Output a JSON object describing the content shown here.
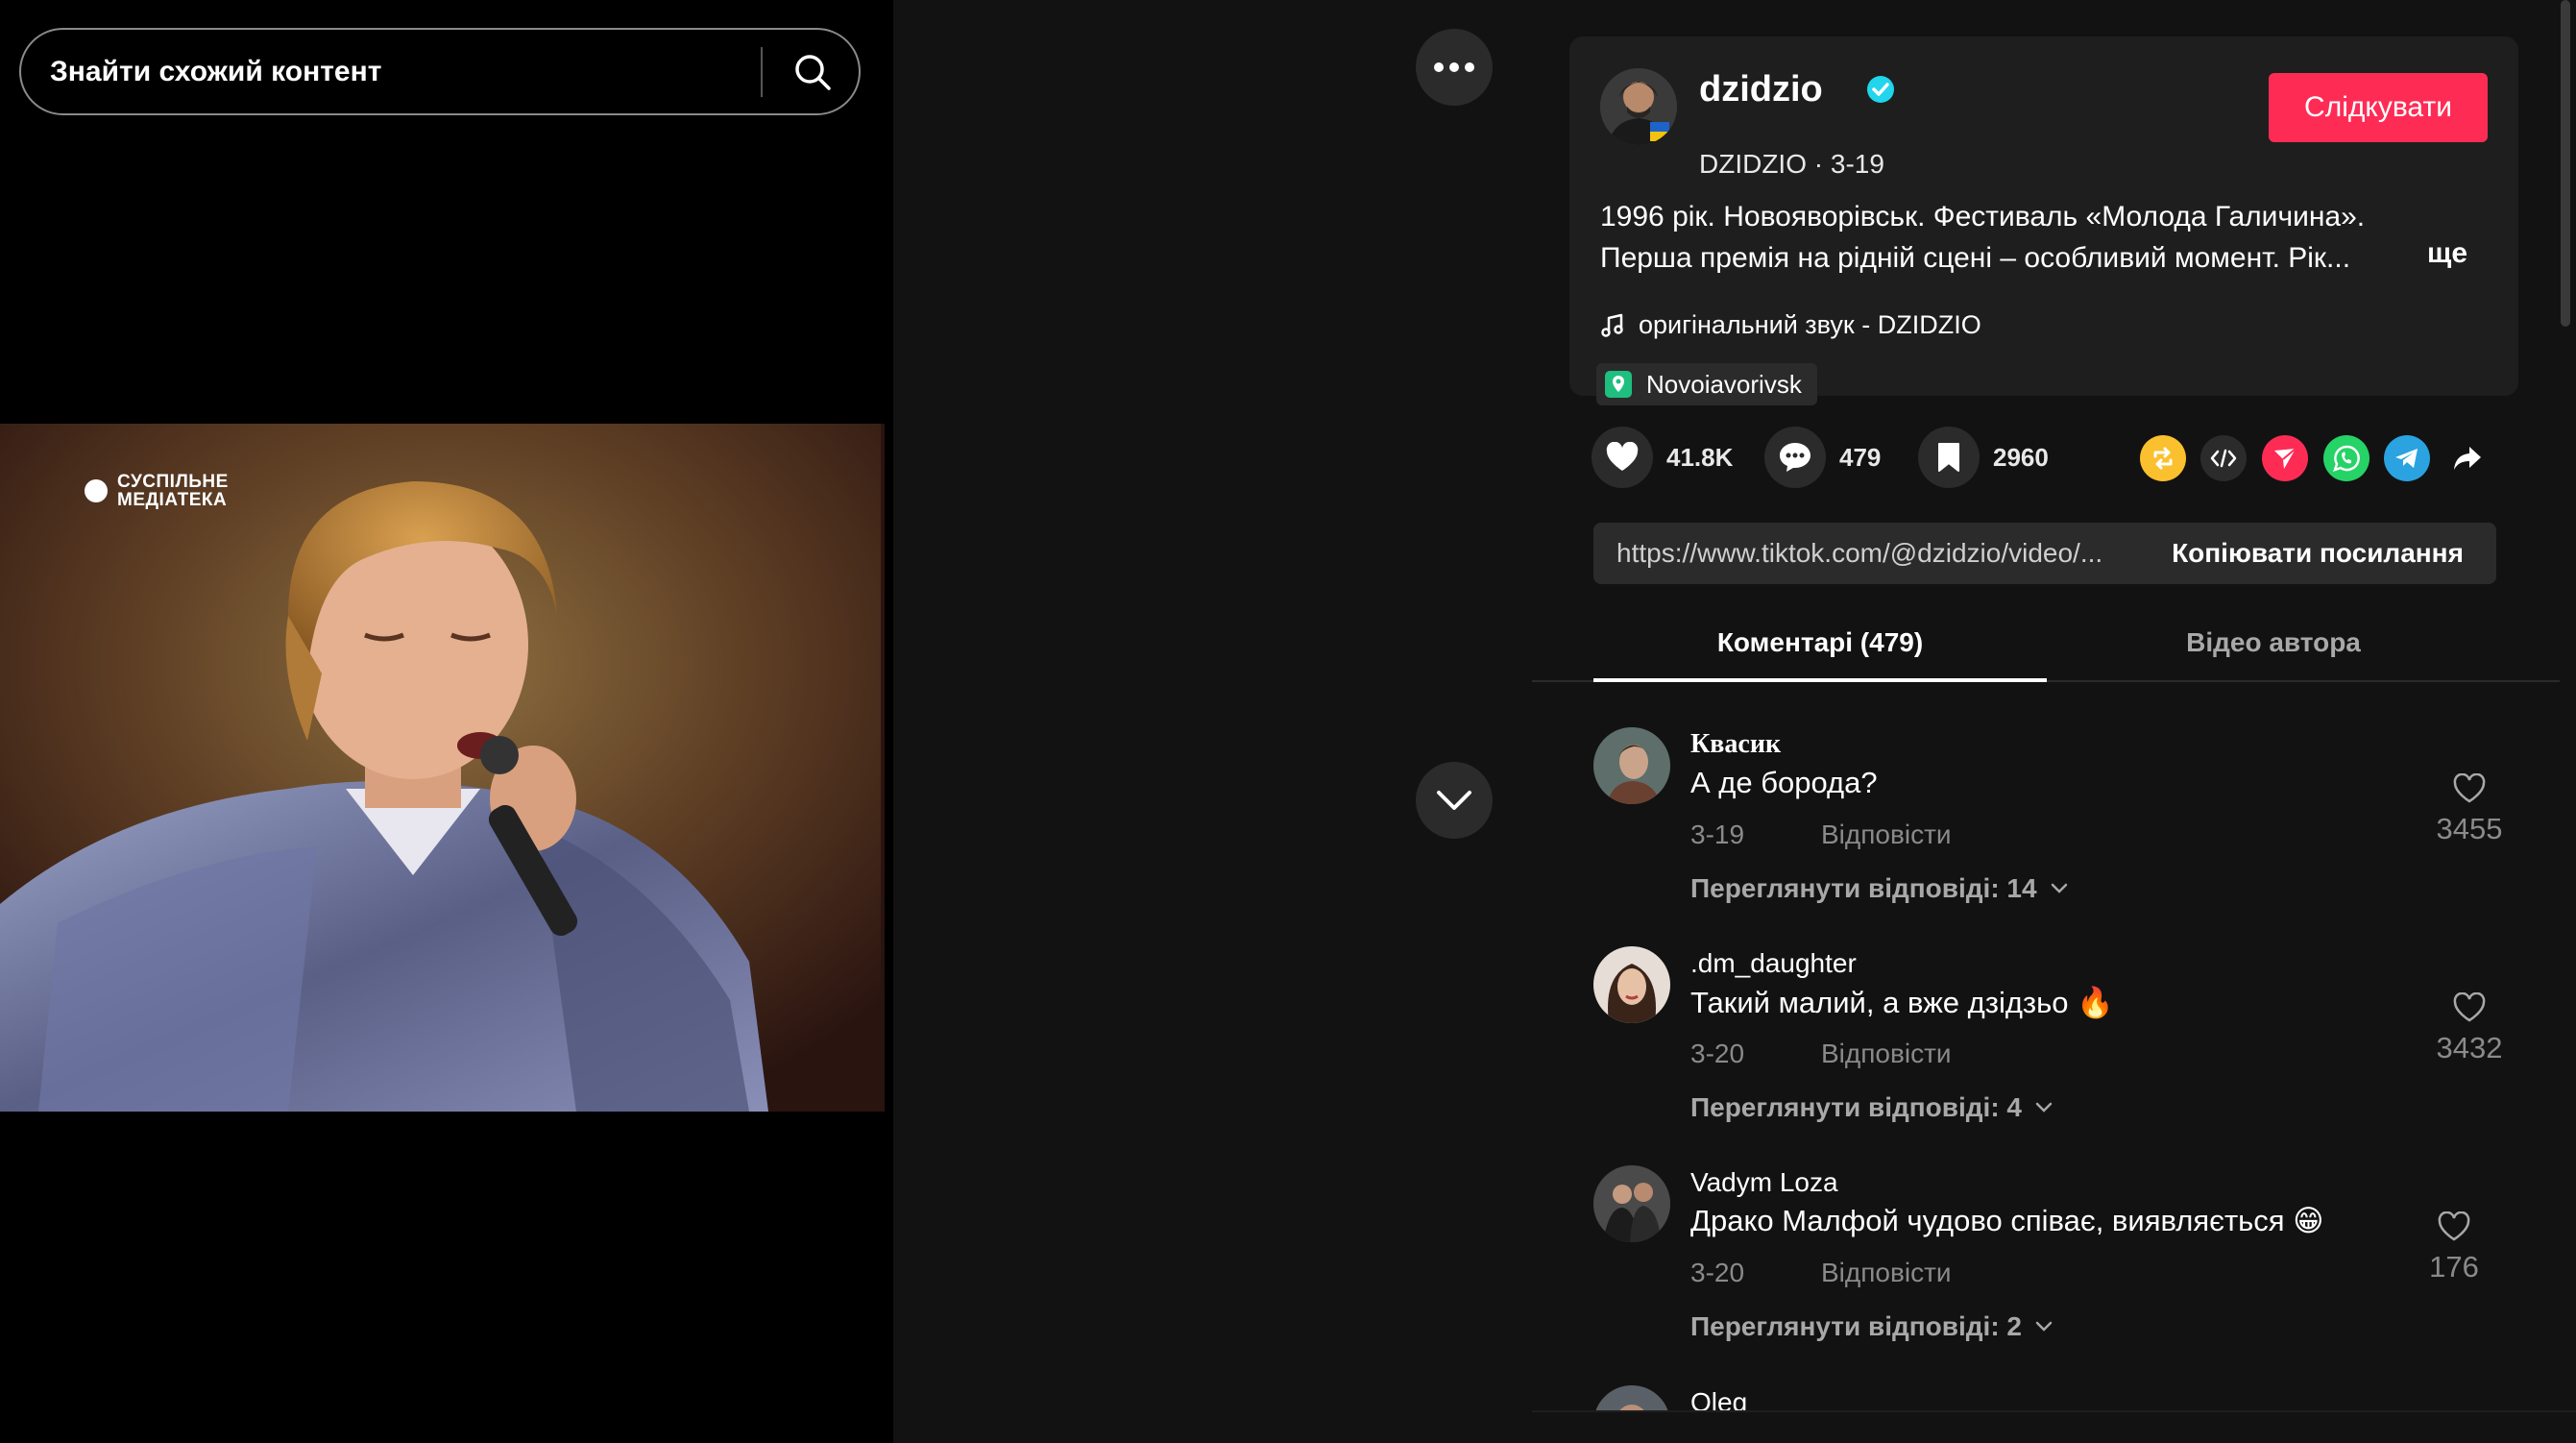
{
  "search": {
    "placeholder": "Знайти схожий контент",
    "search_icon": "search-icon"
  },
  "video": {
    "watermark_line1": "СУСПІЛЬНЕ",
    "watermark_line2": "МЕДІАТЕКА"
  },
  "controls": {
    "more_icon": "more-dots-icon",
    "down_icon": "chevron-down-icon"
  },
  "author": {
    "username": "dzidzio",
    "display_name": "DZIDZIO",
    "separator": "·",
    "date": "3-19",
    "follow_label": "Слідкувати",
    "verified_color": "#20d5ec"
  },
  "description": {
    "text": "1996 рік. Новояворівськ. Фестиваль «Молода Галичина». Перша премія на рідній сцені – особливий момент. Рік...",
    "more_label": "ще"
  },
  "sound": {
    "label": "оригінальний звук - DZIDZIO"
  },
  "location": {
    "label": "Novoiavorivsk"
  },
  "stats": {
    "likes": "41.8K",
    "comments": "479",
    "saves": "2960"
  },
  "share": {
    "repost_color": "#fbc02d",
    "send_color": "#fe2c55",
    "whatsapp_color": "#25d366",
    "telegram_color": "#2aa3e0"
  },
  "link": {
    "url": "https://www.tiktok.com/@dzidzio/video/...",
    "copy_label": "Копіювати посилання"
  },
  "tabs": {
    "comments": "Коментарі (479)",
    "author_videos": "Відео автора"
  },
  "comments": [
    {
      "user": "Квасик",
      "text": "А де борода?",
      "date": "3-19",
      "reply_label": "Відповісти",
      "view_replies": "Переглянути відповіді: 14",
      "likes": "3455"
    },
    {
      "user": ".dm_daughter",
      "text": "Такий малий, а вже дзідзьо 🔥",
      "date": "3-20",
      "reply_label": "Відповісти",
      "view_replies": "Переглянути відповіді: 4",
      "likes": "3432"
    },
    {
      "user": "Vadym Loza",
      "text": "Драко Малфой чудово співає, виявляється 😁",
      "date": "3-20",
      "reply_label": "Відповісти",
      "view_replies": "Переглянути відповіді: 2",
      "likes": "176"
    },
    {
      "user": "Oleg"
    }
  ],
  "theme": {
    "accent": "#fe2c55",
    "panel_bg": "#121212",
    "card_bg": "#1e1e1e"
  }
}
